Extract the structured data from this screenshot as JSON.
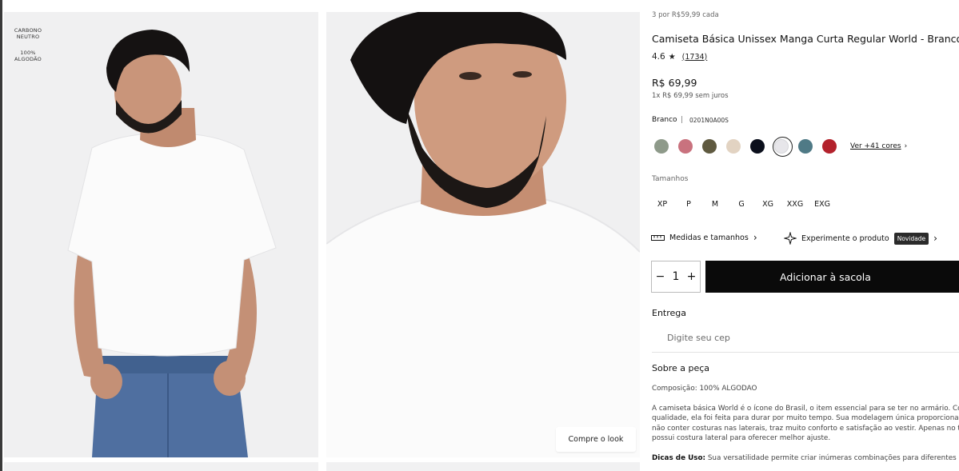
{
  "gallery": {
    "badge_line1": "CARBONO",
    "badge_line2": "NEUTRO",
    "badge_line3": "100%",
    "badge_line4": "ALGODÃO",
    "shop_look_label": "Compre o look"
  },
  "product": {
    "promo": "3 por R$59,99 cada",
    "title": "Camiseta Básica Unissex Manga Curta Regular World - Branco",
    "rating": "4.6",
    "review_count": "(1734)",
    "price": "R$ 69,99",
    "installments": "1x R$ 69,99  sem juros",
    "color_name": "Branco",
    "separator": "|",
    "sku": "0201N0A00S"
  },
  "colors": {
    "swatches": [
      "#8e9a8a",
      "#c9727e",
      "#5f5a40",
      "#e2d3c2",
      "#0b0f1c",
      "#e7e6ea",
      "#4f7a86",
      "#b3222c"
    ],
    "selected_index": 5,
    "more_label": "Ver +41 cores"
  },
  "sizes": {
    "label": "Tamanhos",
    "options": [
      "XP",
      "P",
      "M",
      "G",
      "XG",
      "XXG",
      "EXG"
    ]
  },
  "links": {
    "measures_label": "Medidas e tamanhos",
    "try_label": "Experimente o produto",
    "new_badge": "Novidade"
  },
  "purchase": {
    "quantity": "1",
    "minus": "−",
    "plus": "+",
    "add_label": "Adicionar à sacola"
  },
  "delivery": {
    "title": "Entrega",
    "cep_placeholder": "Digite seu cep"
  },
  "about": {
    "title": "Sobre a peça",
    "composition": "Composição: 100% ALGODAO",
    "desc_line1": "A camiseta básica World é o ícone do Brasil, o item essencial para se ter no armário. Com",
    "desc_line2": "qualidade, ela foi feita para durar por muito tempo. Sua modelagem única proporciona ca",
    "desc_line3": "não conter costuras nas laterais, traz muito conforto e satisfação ao vestir. Apenas no tam",
    "desc_line4": "possui costura lateral para oferecer melhor ajuste.",
    "tips_label": "Dicas de Uso:",
    "tips_text": " Sua versatilidade permite criar inúmeras combinações para diferentes oca"
  }
}
